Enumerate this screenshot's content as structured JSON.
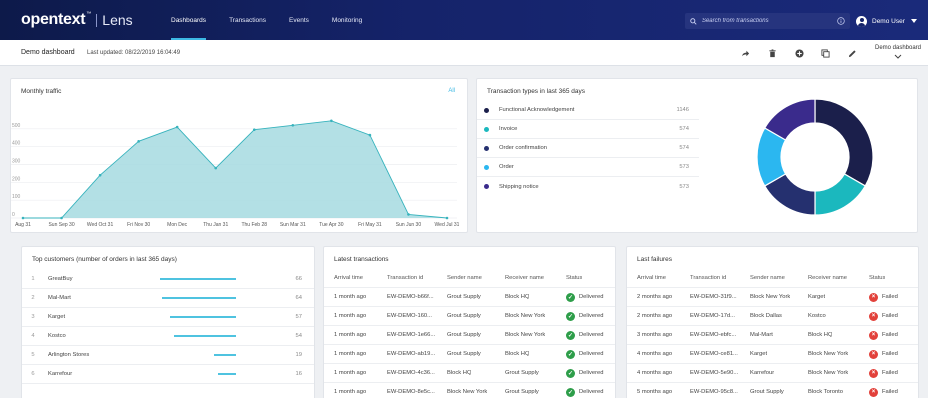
{
  "header": {
    "brand": "opentext",
    "trademark": "™",
    "product": "Lens",
    "nav": [
      {
        "label": "Dashboards",
        "active": true
      },
      {
        "label": "Transactions",
        "active": false
      },
      {
        "label": "Events",
        "active": false
      },
      {
        "label": "Monitoring",
        "active": false
      }
    ],
    "search_placeholder": "Search from transactions",
    "user_name": "Demo User"
  },
  "subbar": {
    "title": "Demo dashboard",
    "updated": "Last updated: 08/22/2019 16:04:49",
    "dashboard_select": "Demo dashboard",
    "toolbar_icons": [
      "share-icon",
      "delete-icon",
      "add-icon",
      "copy-icon",
      "edit-icon"
    ]
  },
  "colors": {
    "accent": "#3db9e4",
    "area_fill": "#a6dbe0",
    "area_stroke": "#37b3bd",
    "nav_bg": "#15236a",
    "success": "#2e9e4a",
    "failure": "#e2413b"
  },
  "monthly_traffic": {
    "title": "Monthly traffic",
    "link": "All",
    "chart_data": {
      "type": "area",
      "x": [
        "Aug 31",
        "Sun Sep 30",
        "Wed Oct 31",
        "Fri Nov 30",
        "Mon Dec",
        "Thu Jan 31",
        "Thu Feb 28",
        "Sun Mar 31",
        "Tue Apr 30",
        "Fri May 31",
        "Sun Jun 30",
        "Wed Jul 31"
      ],
      "values": [
        0,
        0,
        240,
        430,
        510,
        280,
        495,
        520,
        545,
        465,
        20,
        0
      ],
      "y_ticks": [
        0,
        100,
        200,
        300,
        400,
        500
      ],
      "ylim": [
        0,
        600
      ],
      "grid": true
    }
  },
  "transaction_types": {
    "title": "Transaction types in last 365 days",
    "items": [
      {
        "label": "Functional Acknowledgement",
        "count": "1146",
        "color": "#1b1f4b"
      },
      {
        "label": "Invoice",
        "count": "574",
        "color": "#1bb8be"
      },
      {
        "label": "Order confirmation",
        "count": "574",
        "color": "#25306f"
      },
      {
        "label": "Order",
        "count": "573",
        "color": "#2bb7f0"
      },
      {
        "label": "Shipping notice",
        "count": "573",
        "color": "#3a2b8c"
      }
    ],
    "chart_data": {
      "type": "pie",
      "categories": [
        "Functional Acknowledgement",
        "Invoice",
        "Order confirmation",
        "Order",
        "Shipping notice"
      ],
      "values": [
        1146,
        574,
        574,
        573,
        573
      ],
      "donut": true
    }
  },
  "top_customers": {
    "title": "Top customers (number of orders in last 365 days)",
    "rows": [
      {
        "rank": "1",
        "name": "GreatBuy",
        "value": "66"
      },
      {
        "rank": "2",
        "name": "Mal-Mart",
        "value": "64"
      },
      {
        "rank": "3",
        "name": "Karget",
        "value": "57"
      },
      {
        "rank": "4",
        "name": "Kostco",
        "value": "54"
      },
      {
        "rank": "5",
        "name": "Arlington Stores",
        "value": "19"
      },
      {
        "rank": "6",
        "name": "Karrefour",
        "value": "16"
      }
    ]
  },
  "latest_transactions": {
    "title": "Latest transactions",
    "columns": [
      "Arrival time",
      "Transaction id",
      "Sender name",
      "Receiver name",
      "Status"
    ],
    "rows": [
      [
        "1 month ago",
        "EW-DEMO-b66f...",
        "Grout Supply",
        "Block HQ",
        "Delivered"
      ],
      [
        "1 month ago",
        "EW-DEMO-160...",
        "Grout Supply",
        "Block New York",
        "Delivered"
      ],
      [
        "1 month ago",
        "EW-DEMO-1e66...",
        "Grout Supply",
        "Block New York",
        "Delivered"
      ],
      [
        "1 month ago",
        "EW-DEMO-ab19...",
        "Grout Supply",
        "Block HQ",
        "Delivered"
      ],
      [
        "1 month ago",
        "EW-DEMO-4c36...",
        "Block HQ",
        "Grout Supply",
        "Delivered"
      ],
      [
        "1 month ago",
        "EW-DEMO-8e5c...",
        "Block New York",
        "Grout Supply",
        "Delivered"
      ]
    ]
  },
  "last_failures": {
    "title": "Last failures",
    "columns": [
      "Arrival time",
      "Transaction id",
      "Sender name",
      "Receiver name",
      "Status"
    ],
    "rows": [
      [
        "2 months ago",
        "EW-DEMO-31f9...",
        "Block New York",
        "Karget",
        "Failed"
      ],
      [
        "2 months ago",
        "EW-DEMO-17d...",
        "Block Dallas",
        "Kostco",
        "Failed"
      ],
      [
        "3 months ago",
        "EW-DEMO-ebfc...",
        "Mal-Mart",
        "Block HQ",
        "Failed"
      ],
      [
        "4 months ago",
        "EW-DEMO-ce81...",
        "Karget",
        "Block New York",
        "Failed"
      ],
      [
        "4 months ago",
        "EW-DEMO-5e90...",
        "Karrefour",
        "Block New York",
        "Failed"
      ],
      [
        "5 months ago",
        "EW-DEMO-95c8...",
        "Grout Supply",
        "Block Toronto",
        "Failed"
      ]
    ]
  }
}
